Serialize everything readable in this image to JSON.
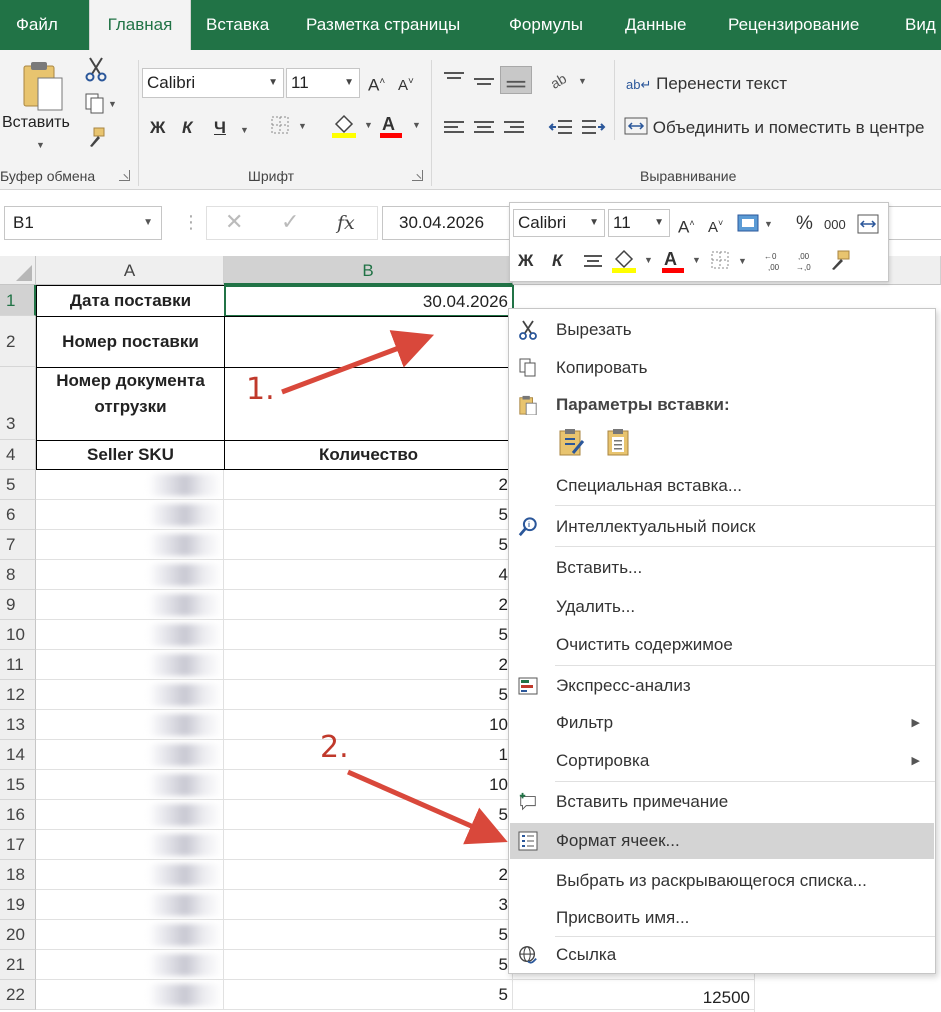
{
  "ribbon": {
    "tabs": [
      "Файл",
      "Главная",
      "Вставка",
      "Разметка страницы",
      "Формулы",
      "Данные",
      "Рецензирование",
      "Вид"
    ],
    "active_tab": "Главная",
    "paste_label": "Вставить",
    "clipboard_label": "Буфер обмена",
    "font_group_label": "Шрифт",
    "align_group_label": "Выравнивание",
    "font_name": "Calibri",
    "font_size": "11",
    "bold": "Ж",
    "italic": "К",
    "underline": "Ч",
    "wrap_text": "Перенести текст",
    "merge_center": "Объединить и поместить в центре"
  },
  "formula_bar": {
    "name_box": "B1",
    "fx": "fx",
    "value": "30.04.2026"
  },
  "mini_toolbar": {
    "font_name": "Calibri",
    "font_size": "11",
    "percent": "%",
    "thousands": "000",
    "bold": "Ж",
    "italic": "К"
  },
  "sheet": {
    "columns": [
      "A",
      "B"
    ],
    "rows": [
      "1",
      "2",
      "3",
      "4",
      "5",
      "6",
      "7",
      "8",
      "9",
      "10",
      "11",
      "12",
      "13",
      "14",
      "15",
      "16",
      "17",
      "18",
      "19",
      "20",
      "21",
      "22"
    ],
    "a1": "Дата поставки",
    "b1": "30.04.2026",
    "a2": "Номер поставки",
    "a3": "Номер документа отгрузки",
    "a4": "Seller SKU",
    "b4": "Количество",
    "quantities": [
      "2",
      "5",
      "5",
      "4",
      "2",
      "5",
      "2",
      "5",
      "10",
      "1",
      "10",
      "5",
      "",
      "2",
      "3",
      "5",
      "5",
      "5"
    ],
    "c22": "12500"
  },
  "context_menu": {
    "items": [
      {
        "label": "Вырезать",
        "icon": "scissors-icon"
      },
      {
        "label": "Копировать",
        "icon": "copy-icon"
      },
      {
        "label": "Параметры вставки:",
        "icon": "paste-icon"
      },
      {
        "label": "Специальная вставка...",
        "icon": ""
      },
      {
        "label": "Интеллектуальный поиск",
        "icon": "smart-lookup-icon"
      },
      {
        "label": "Вставить...",
        "icon": ""
      },
      {
        "label": "Удалить...",
        "icon": ""
      },
      {
        "label": "Очистить содержимое",
        "icon": ""
      },
      {
        "label": "Экспресс-анализ",
        "icon": "quick-analysis-icon"
      },
      {
        "label": "Фильтр",
        "icon": ""
      },
      {
        "label": "Сортировка",
        "icon": ""
      },
      {
        "label": "Вставить примечание",
        "icon": "comment-icon"
      },
      {
        "label": "Формат ячеек...",
        "icon": "format-cells-icon"
      },
      {
        "label": "Выбрать из раскрывающегося списка...",
        "icon": ""
      },
      {
        "label": "Присвоить имя...",
        "icon": ""
      },
      {
        "label": "Ссылка",
        "icon": "link-icon"
      }
    ],
    "highlighted": "Формат ячеек..."
  },
  "annotations": [
    "1.",
    "2."
  ],
  "colors": {
    "excel_green": "#217346",
    "arrow_red": "#d9483b",
    "highlight": "#d4d4d4"
  }
}
